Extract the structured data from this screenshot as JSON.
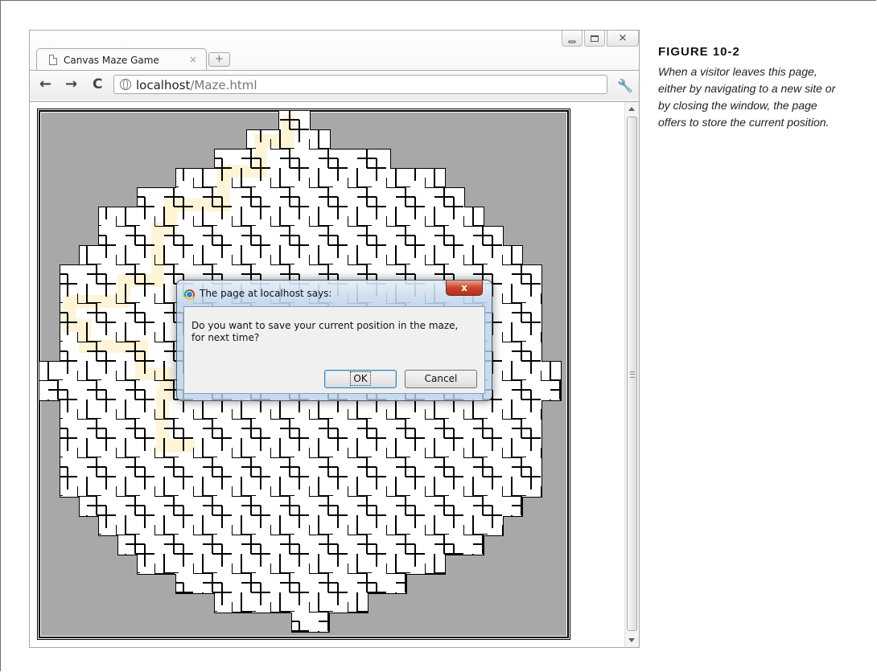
{
  "browser": {
    "tab_title": "Canvas Maze Game",
    "tab_close": "×",
    "new_tab": "+",
    "url_host": "localhost",
    "url_path": "/Maze.html",
    "nav": {
      "back": "←",
      "forward": "→",
      "reload": "C"
    },
    "wrench": "🔧"
  },
  "maze": {
    "colors": {
      "background": "#a8a8a8",
      "corridor": "#ffffff",
      "trail": "#fff4d6",
      "walls": "#000000"
    }
  },
  "dialog": {
    "title": "The page at localhost says:",
    "close": "x",
    "message": "Do you want to save your current position in the maze, for next time?",
    "ok_label": "OK",
    "cancel_label": "Cancel"
  },
  "caption": {
    "label": "FIGURE 10-2",
    "text": "When a visitor leaves this page, either by navigating to a new site or by closing the window, the page offers to store the current position."
  }
}
